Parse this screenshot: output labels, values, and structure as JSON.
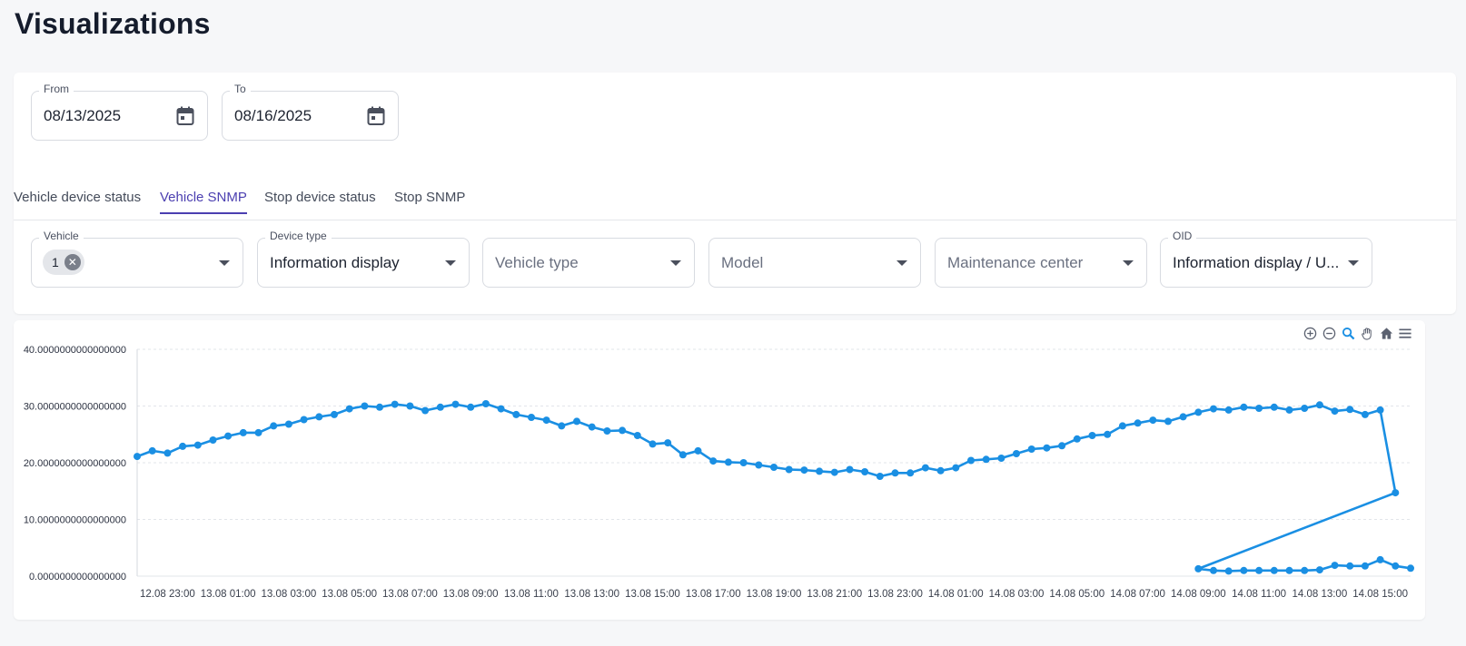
{
  "page": {
    "title": "Visualizations"
  },
  "date_range": {
    "from": {
      "label": "From",
      "value": "08/13/2025"
    },
    "to": {
      "label": "To",
      "value": "08/16/2025"
    }
  },
  "tabs": [
    {
      "label": "Vehicle device status",
      "active": false
    },
    {
      "label": "Vehicle SNMP",
      "active": true
    },
    {
      "label": "Stop device status",
      "active": false
    },
    {
      "label": "Stop SNMP",
      "active": false
    }
  ],
  "filters": {
    "vehicle": {
      "label": "Vehicle",
      "chip": "1"
    },
    "device_type": {
      "label": "Device type",
      "value": "Information display"
    },
    "vehicle_type": {
      "placeholder": "Vehicle type"
    },
    "model": {
      "placeholder": "Model"
    },
    "maintenance_center": {
      "placeholder": "Maintenance center"
    },
    "oid": {
      "label": "OID",
      "value": "Information display / U..."
    }
  },
  "toolbar": {
    "icons": [
      "zoom-in-icon",
      "zoom-out-icon",
      "selection-zoom-icon",
      "pan-hand-icon",
      "home-reset-icon",
      "menu-icon"
    ],
    "active_icon": "selection-zoom-icon"
  },
  "colors": {
    "accent": "#4b3fb0",
    "series": "#1a8fe3"
  },
  "chart_data": {
    "type": "line",
    "ylim": [
      0,
      40
    ],
    "yticks": [
      0,
      10,
      20,
      30,
      40
    ],
    "ytick_labels": [
      "0.0000000000000000",
      "10.0000000000000000",
      "20.0000000000000000",
      "30.0000000000000000",
      "40.0000000000000000"
    ],
    "xticks": [
      "12.08 23:00",
      "13.08 01:00",
      "13.08 03:00",
      "13.08 05:00",
      "13.08 07:00",
      "13.08 09:00",
      "13.08 11:00",
      "13.08 13:00",
      "13.08 15:00",
      "13.08 17:00",
      "13.08 19:00",
      "13.08 21:00",
      "13.08 23:00",
      "14.08 01:00",
      "14.08 03:00",
      "14.08 05:00",
      "14.08 07:00",
      "14.08 09:00",
      "14.08 11:00",
      "14.08 13:00",
      "14.08 15:00"
    ],
    "grid": true,
    "series": [
      {
        "x": [
          "12.08 22:00",
          "12.08 22:30",
          "12.08 23:00",
          "12.08 23:30",
          "13.08 00:00",
          "13.08 00:30",
          "13.08 01:00",
          "13.08 01:30",
          "13.08 02:00",
          "13.08 02:30",
          "13.08 03:00",
          "13.08 03:30",
          "13.08 04:00",
          "13.08 04:30",
          "13.08 05:00",
          "13.08 05:30",
          "13.08 06:00",
          "13.08 06:30",
          "13.08 07:00",
          "13.08 07:30",
          "13.08 08:00",
          "13.08 08:30",
          "13.08 09:00",
          "13.08 09:30",
          "13.08 10:00",
          "13.08 10:30",
          "13.08 11:00",
          "13.08 11:30",
          "13.08 12:00",
          "13.08 12:30",
          "13.08 13:00",
          "13.08 13:30",
          "13.08 14:00",
          "13.08 14:30",
          "13.08 15:00",
          "13.08 15:30",
          "13.08 16:00",
          "13.08 16:30",
          "13.08 17:00",
          "13.08 17:30",
          "13.08 18:00",
          "13.08 18:30",
          "13.08 19:00",
          "13.08 19:30",
          "13.08 20:00",
          "13.08 20:30",
          "13.08 21:00",
          "13.08 21:30",
          "13.08 22:00",
          "13.08 22:30",
          "13.08 23:00",
          "13.08 23:30",
          "14.08 00:00",
          "14.08 00:30",
          "14.08 01:00",
          "14.08 01:30",
          "14.08 02:00",
          "14.08 02:30",
          "14.08 03:00",
          "14.08 03:30",
          "14.08 04:00",
          "14.08 04:30",
          "14.08 05:00",
          "14.08 05:30",
          "14.08 06:00",
          "14.08 06:30",
          "14.08 07:00",
          "14.08 07:30",
          "14.08 08:00",
          "14.08 08:30",
          "14.08 09:00",
          "14.08 09:30",
          "14.08 10:00",
          "14.08 10:30",
          "14.08 11:00",
          "14.08 11:30",
          "14.08 12:00",
          "14.08 12:30",
          "14.08 13:00",
          "14.08 13:30",
          "14.08 14:00",
          "14.08 14:30",
          "14.08 15:00",
          "14.08 15:30"
        ],
        "values": [
          21.1,
          22.1,
          21.7,
          22.9,
          23.1,
          24.0,
          24.7,
          25.3,
          25.3,
          26.5,
          26.8,
          27.6,
          28.1,
          28.5,
          29.5,
          30.0,
          29.8,
          30.3,
          30.0,
          29.2,
          29.8,
          30.3,
          29.8,
          30.4,
          29.5,
          28.5,
          28.0,
          27.5,
          26.5,
          27.3,
          26.3,
          25.6,
          25.7,
          24.8,
          23.3,
          23.5,
          21.4,
          22.1,
          20.3,
          20.1,
          20.0,
          19.6,
          19.2,
          18.8,
          18.7,
          18.5,
          18.3,
          18.8,
          18.4,
          17.6,
          18.2,
          18.2,
          19.1,
          18.6,
          19.1,
          20.4,
          20.6,
          20.8,
          21.6,
          22.4,
          22.6,
          23.0,
          24.2,
          24.8,
          25.0,
          26.5,
          27.0,
          27.5,
          27.3,
          28.1,
          28.9,
          29.5,
          29.3,
          29.8,
          29.6,
          29.8,
          29.3,
          29.6,
          30.2,
          29.1,
          29.4,
          28.5,
          29.3,
          14.7
        ]
      },
      {
        "x": [
          "14.08 09:00",
          "14.08 09:30",
          "14.08 10:00",
          "14.08 10:30",
          "14.08 11:00",
          "14.08 11:30",
          "14.08 12:00",
          "14.08 12:30",
          "14.08 13:00",
          "14.08 13:30",
          "14.08 14:00",
          "14.08 14:30",
          "14.08 15:00",
          "14.08 15:30",
          "14.08 16:00"
        ],
        "values": [
          1.3,
          1.0,
          0.9,
          1.0,
          1.0,
          1.0,
          1.0,
          1.0,
          1.1,
          1.9,
          1.8,
          1.8,
          2.9,
          1.8,
          1.4
        ]
      }
    ]
  }
}
